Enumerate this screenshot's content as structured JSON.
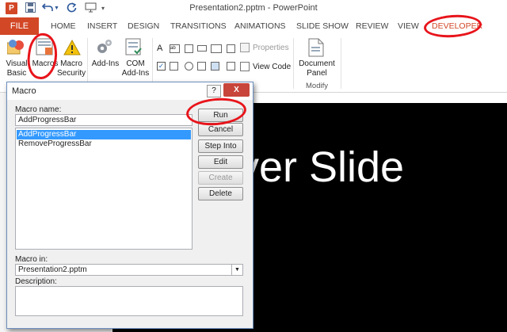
{
  "window": {
    "title": "Presentation2.pptm - PowerPoint"
  },
  "quick_access": [
    "powerpoint-logo-icon",
    "save-icon",
    "undo-icon",
    "redo-icon",
    "present-icon",
    "customize-qat-icon"
  ],
  "tabs": {
    "file": "FILE",
    "items": [
      "HOME",
      "INSERT",
      "DESIGN",
      "TRANSITIONS",
      "ANIMATIONS",
      "SLIDE SHOW",
      "REVIEW",
      "VIEW",
      "DEVELOPER"
    ]
  },
  "ribbon": {
    "visual_basic": [
      "Visual",
      "Basic"
    ],
    "macros": "Macros",
    "macro_security": [
      "Macro",
      "Security"
    ],
    "add_ins": "Add-Ins",
    "com_add_ins": [
      "COM",
      "Add-Ins"
    ],
    "properties": "Properties",
    "view_code": "View Code",
    "document_panel": [
      "Document",
      "Panel"
    ],
    "modify_group": "Modify"
  },
  "slide": {
    "text": "ver Slide"
  },
  "dialog": {
    "title": "Macro",
    "help": "?",
    "close": "X",
    "macro_name_label": "Macro name:",
    "macro_name_value": "AddProgressBar",
    "macros": [
      "AddProgressBar",
      "RemoveProgressBar"
    ],
    "selected_index": 0,
    "buttons": {
      "run": "Run",
      "cancel": "Cancel",
      "step_into": "Step Into",
      "edit": "Edit",
      "create": "Create",
      "delete": "Delete"
    },
    "macro_in_label": "Macro in:",
    "macro_in_value": "Presentation2.pptm",
    "description_label": "Description:"
  },
  "colors": {
    "file_tab": "#d24726",
    "developer_tab": "#d24726",
    "annotation_red": "#e8141b",
    "selection": "#3399ff"
  }
}
